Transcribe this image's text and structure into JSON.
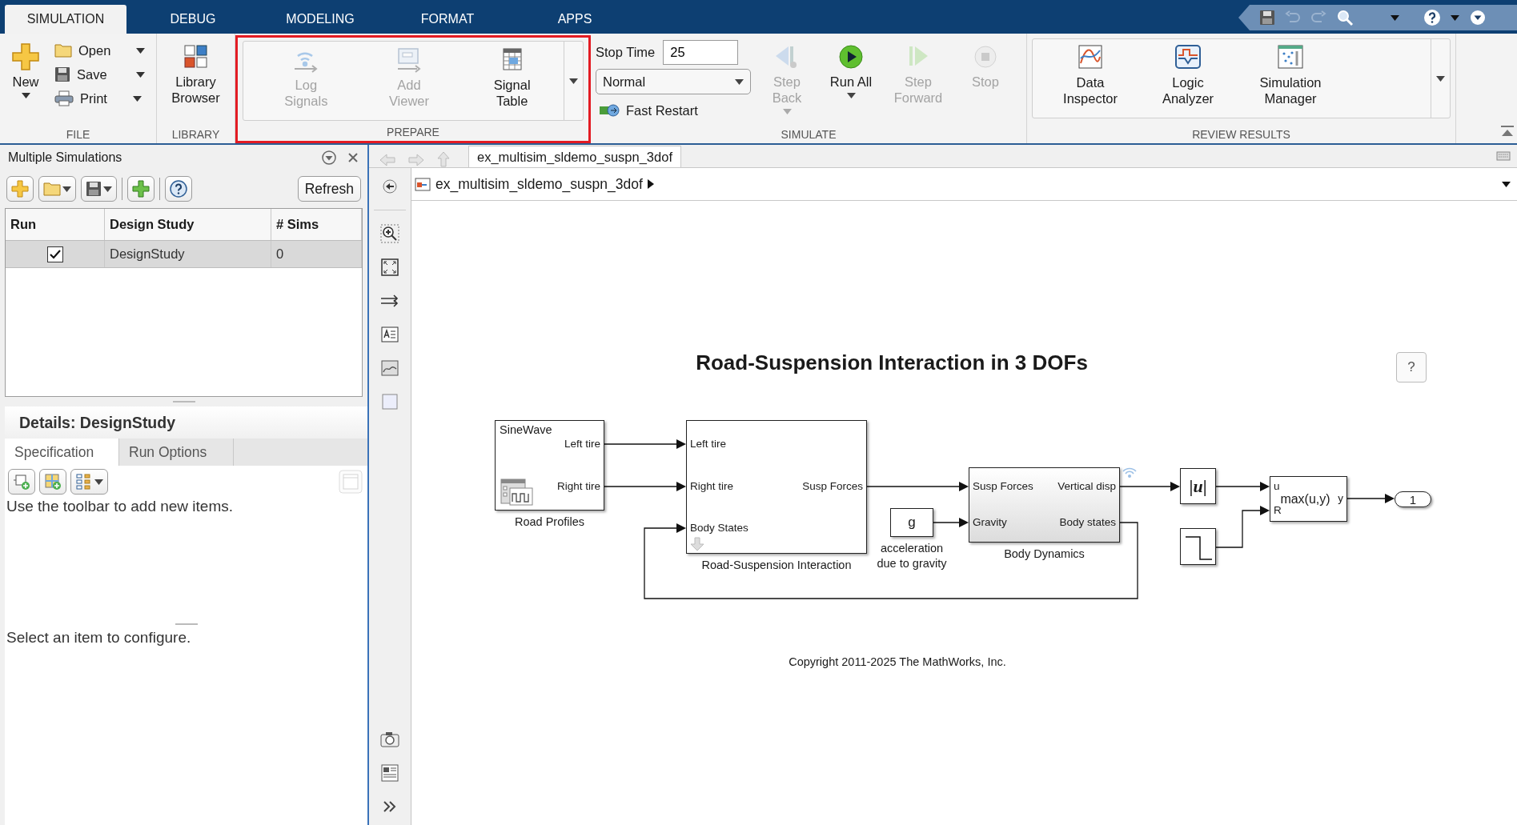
{
  "ribbon_tabs": [
    {
      "label": "SIMULATION",
      "selected": true
    },
    {
      "label": "DEBUG",
      "selected": false
    },
    {
      "label": "MODELING",
      "selected": false
    },
    {
      "label": "FORMAT",
      "selected": false
    },
    {
      "label": "APPS",
      "selected": false
    }
  ],
  "file_group": {
    "title": "FILE",
    "new": "New",
    "open": "Open",
    "save": "Save",
    "print": "Print"
  },
  "library_group": {
    "title": "LIBRARY",
    "button": "Library Browser"
  },
  "prepare_group": {
    "title": "PREPARE",
    "highlighted": true,
    "buttons": [
      {
        "label": "Log Signals",
        "disabled": true
      },
      {
        "label": "Add Viewer",
        "disabled": true
      },
      {
        "label": "Signal Table",
        "disabled": false
      }
    ]
  },
  "simulate_group": {
    "title": "SIMULATE",
    "stop_time_label": "Stop Time",
    "stop_time": "25",
    "mode": "Normal",
    "fast_restart": "Fast Restart",
    "buttons": [
      {
        "label": "Step Back",
        "disabled": true,
        "menu": true
      },
      {
        "label": "Run All",
        "disabled": false,
        "menu": true
      },
      {
        "label": "Step Forward",
        "disabled": true,
        "menu": false
      },
      {
        "label": "Stop",
        "disabled": true,
        "menu": false
      }
    ]
  },
  "review_group": {
    "title": "REVIEW RESULTS",
    "buttons": [
      "Data Inspector",
      "Logic Analyzer",
      "Simulation Manager"
    ]
  },
  "multiple_simulations": {
    "title": "Multiple Simulations",
    "refresh": "Refresh",
    "columns": [
      "Run",
      "Design Study",
      "# Sims"
    ],
    "rows": [
      {
        "run": true,
        "name": "DesignStudy",
        "sims": "0",
        "selected": true
      }
    ],
    "details_title": "Details: DesignStudy",
    "tabs": [
      {
        "label": "Specification",
        "selected": true
      },
      {
        "label": "Run Options",
        "selected": false
      }
    ],
    "hint": "Use the toolbar to add new items.",
    "config_hint": "Select an item to configure."
  },
  "editor_tab": "ex_multisim_sldemo_suspn_3dof",
  "breadcrumb": "ex_multisim_sldemo_suspn_3dof",
  "diagram": {
    "title": "Road-Suspension Interaction in 3 DOFs",
    "help": "?",
    "copyright": "Copyright 2011-2025 The MathWorks, Inc.",
    "blocks": [
      {
        "kind": "signal_editor",
        "name": "Road Profiles",
        "scenario": "SineWave",
        "outputs": [
          "Left tire",
          "Right tire"
        ]
      },
      {
        "kind": "subsystem",
        "name": "Road-Suspension Interaction",
        "inputs": [
          "Left tire",
          "Right tire",
          "Body States"
        ],
        "outputs": [
          "Susp Forces"
        ]
      },
      {
        "kind": "constant",
        "name": "acceleration due to gravity",
        "value": "g"
      },
      {
        "kind": "subsystem",
        "name": "Body Dynamics",
        "inputs": [
          "Susp Forces",
          "Gravity"
        ],
        "outputs": [
          "Vertical disp",
          "Body states"
        ]
      },
      {
        "kind": "abs",
        "value": "|*u*|"
      },
      {
        "kind": "step"
      },
      {
        "kind": "assertion",
        "value": "max(u,y)",
        "inputs": [
          "u",
          "R"
        ],
        "outputs": [
          "y"
        ]
      },
      {
        "kind": "outport",
        "value": "1"
      }
    ]
  }
}
